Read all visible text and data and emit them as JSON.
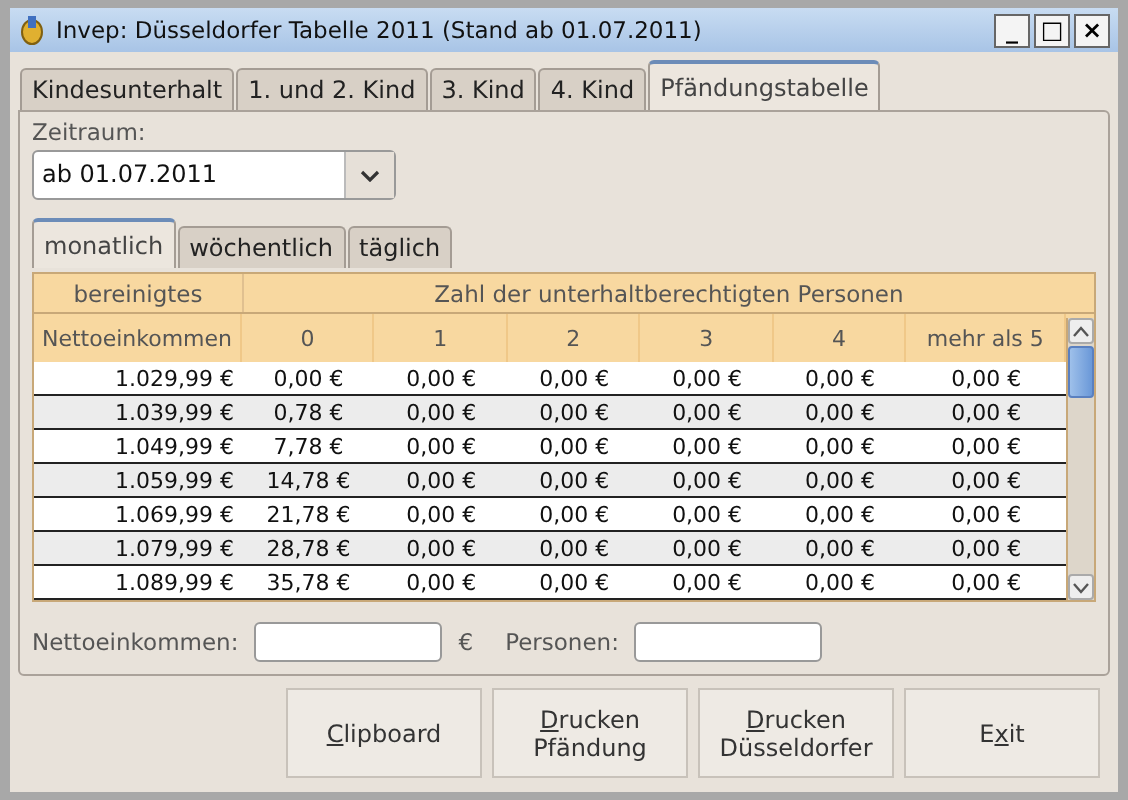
{
  "window": {
    "title": "Invep: Düsseldorfer Tabelle 2011 (Stand ab 01.07.2011)",
    "controls": [
      "_",
      "□",
      "×"
    ]
  },
  "tabs": [
    {
      "label": "Kindesunterhalt",
      "selected": false
    },
    {
      "label": "1. und 2. Kind",
      "selected": false
    },
    {
      "label": "3. Kind",
      "selected": false
    },
    {
      "label": "4. Kind",
      "selected": false
    },
    {
      "label": "Pfändungstabelle",
      "selected": true
    }
  ],
  "period": {
    "label": "Zeitraum:",
    "value": "ab 01.07.2011"
  },
  "subtabs": [
    {
      "label": "monatlich",
      "selected": true
    },
    {
      "label": "wöchentlich",
      "selected": false
    },
    {
      "label": "täglich",
      "selected": false
    }
  ],
  "table": {
    "group_headers": [
      "bereinigtes",
      "Zahl der unterhaltberechtigten Personen"
    ],
    "columns": [
      "Nettoeinkommen",
      "0",
      "1",
      "2",
      "3",
      "4",
      "mehr als 5"
    ],
    "rows": [
      [
        "1.029,99 €",
        "0,00 €",
        "0,00 €",
        "0,00 €",
        "0,00 €",
        "0,00 €",
        "0,00 €"
      ],
      [
        "1.039,99 €",
        "0,78 €",
        "0,00 €",
        "0,00 €",
        "0,00 €",
        "0,00 €",
        "0,00 €"
      ],
      [
        "1.049,99 €",
        "7,78 €",
        "0,00 €",
        "0,00 €",
        "0,00 €",
        "0,00 €",
        "0,00 €"
      ],
      [
        "1.059,99 €",
        "14,78 €",
        "0,00 €",
        "0,00 €",
        "0,00 €",
        "0,00 €",
        "0,00 €"
      ],
      [
        "1.069,99 €",
        "21,78 €",
        "0,00 €",
        "0,00 €",
        "0,00 €",
        "0,00 €",
        "0,00 €"
      ],
      [
        "1.079,99 €",
        "28,78 €",
        "0,00 €",
        "0,00 €",
        "0,00 €",
        "0,00 €",
        "0,00 €"
      ],
      [
        "1.089,99 €",
        "35,78 €",
        "0,00 €",
        "0,00 €",
        "0,00 €",
        "0,00 €",
        "0,00 €"
      ]
    ]
  },
  "inputs": {
    "income_label": "Nettoeinkommen:",
    "currency": "€",
    "persons_label": "Personen:"
  },
  "buttons": [
    {
      "lines": [
        [
          {
            "text": "C",
            "underlined": true
          },
          {
            "text": "lipboard",
            "underlined": false
          }
        ]
      ]
    },
    {
      "lines": [
        [
          {
            "text": "D",
            "underlined": true
          },
          {
            "text": "rucken",
            "underlined": false
          }
        ],
        [
          {
            "text": "Pfändung",
            "underlined": false
          }
        ]
      ]
    },
    {
      "lines": [
        [
          {
            "text": "D",
            "underlined": true
          },
          {
            "text": "rucken",
            "underlined": false
          }
        ],
        [
          {
            "text": "Düsseldorfer",
            "underlined": false
          }
        ]
      ]
    },
    {
      "lines": [
        [
          {
            "text": "E",
            "underlined": false
          },
          {
            "text": "x",
            "underlined": true
          },
          {
            "text": "it",
            "underlined": false
          }
        ]
      ]
    }
  ]
}
